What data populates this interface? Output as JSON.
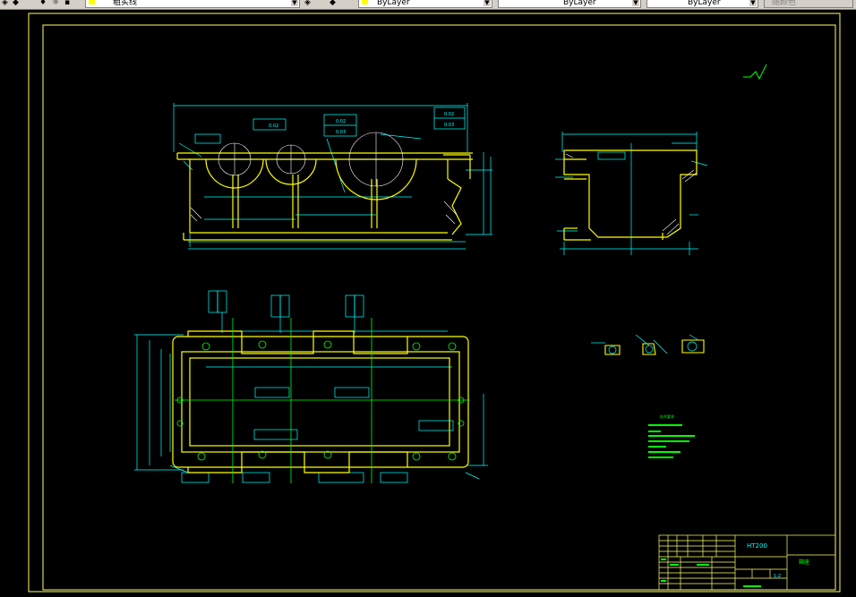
{
  "toolbar": {
    "layer_name": "粗实线",
    "color_value": "ByLayer",
    "linetype_value": "ByLayer",
    "lineweight_value": "ByLayer",
    "plotstyle_value": "随颜色"
  },
  "drawing": {
    "material": "HT200",
    "part_name": "箱座",
    "scale": "1:2",
    "notes_title": "技术要求"
  },
  "colors": {
    "background": "#000000",
    "border": "#ffff66",
    "outline": "#ffff00",
    "dimension": "#00ffff",
    "centerline": "#00ff00",
    "hatch": "#ffffff",
    "annotation": "#00ff00"
  }
}
